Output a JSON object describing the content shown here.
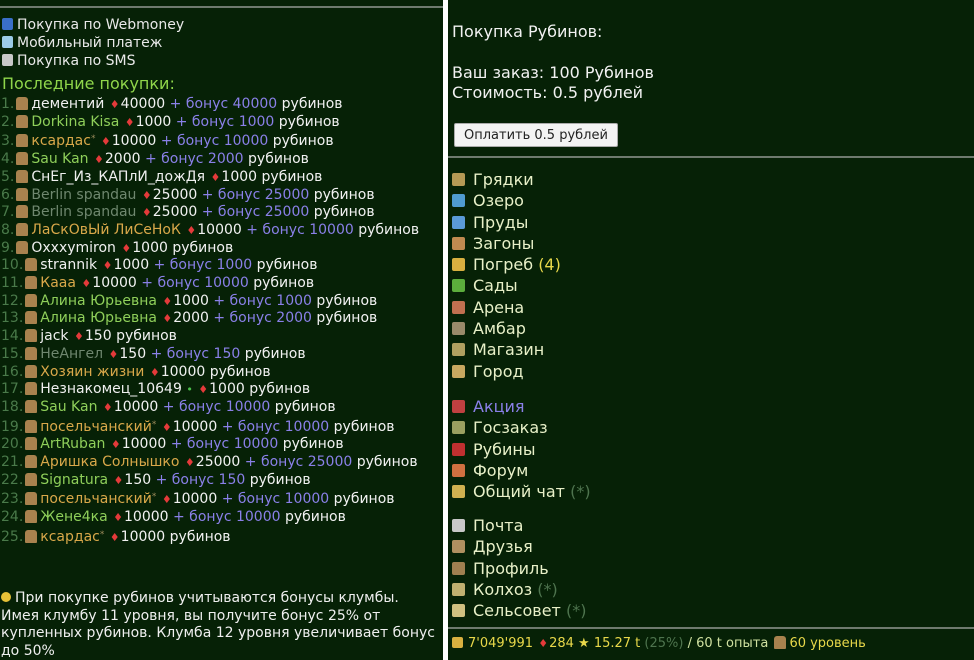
{
  "payment_methods": [
    "Покупка по Webmoney",
    "Мобильный платеж",
    "Покупка по SMS"
  ],
  "recent": {
    "title": "Последние покупки:",
    "items": [
      {
        "n": "1.",
        "name": "дементий",
        "amount": "40000",
        "bonus": "+ бонус 40000",
        "unit": "рубинов",
        "style": "w"
      },
      {
        "n": "2.",
        "name": "Dorkina Kisa",
        "amount": "1000",
        "bonus": "+ бонус 1000",
        "unit": "рубинов",
        "style": "g"
      },
      {
        "n": "3.",
        "name": "ксардас",
        "amount": "10000",
        "bonus": "+ бонус 10000",
        "unit": "рубинов",
        "style": "o",
        "star": "*"
      },
      {
        "n": "4.",
        "name": "Sau Kan",
        "amount": "2000",
        "bonus": "+ бонус 2000",
        "unit": "рубинов",
        "style": "g"
      },
      {
        "n": "5.",
        "name": "СнЕг_Из_КАПлИ_дожДя",
        "amount": "1000",
        "bonus": "",
        "unit": "рубинов",
        "style": "w"
      },
      {
        "n": "6.",
        "name": "Berlin spandau",
        "amount": "25000",
        "bonus": "+ бонус 25000",
        "unit": "рубинов",
        "style": "d"
      },
      {
        "n": "7.",
        "name": "Berlin spandau",
        "amount": "25000",
        "bonus": "+ бонус 25000",
        "unit": "рубинов",
        "style": "d"
      },
      {
        "n": "8.",
        "name": "ЛаСкОвЫй ЛиСеНоК",
        "amount": "10000",
        "bonus": "+ бонус 10000",
        "unit": "рубинов",
        "style": "o"
      },
      {
        "n": "9.",
        "name": "Oxxxymiron",
        "amount": "1000",
        "bonus": "",
        "unit": "рубинов",
        "style": "w"
      },
      {
        "n": "10.",
        "name": "strannik",
        "amount": "1000",
        "bonus": "+ бонус 1000",
        "unit": "рубинов",
        "style": "w"
      },
      {
        "n": "11.",
        "name": "Кааа",
        "amount": "10000",
        "bonus": "+ бонус 10000",
        "unit": "рубинов",
        "style": "o"
      },
      {
        "n": "12.",
        "name": "Алина Юрьевна",
        "amount": "1000",
        "bonus": "+ бонус 1000",
        "unit": "рубинов",
        "style": "g"
      },
      {
        "n": "13.",
        "name": "Алина Юрьевна",
        "amount": "2000",
        "bonus": "+ бонус 2000",
        "unit": "рубинов",
        "style": "g"
      },
      {
        "n": "14.",
        "name": "jack",
        "amount": "150",
        "bonus": "",
        "unit": "рубинов",
        "style": "w"
      },
      {
        "n": "15.",
        "name": "НеАнгел",
        "amount": "150",
        "bonus": "+ бонус 150",
        "unit": "рубинов",
        "style": "d"
      },
      {
        "n": "16.",
        "name": "Хозяин жизни",
        "amount": "10000",
        "bonus": "",
        "unit": "рубинов",
        "style": "o"
      },
      {
        "n": "17.",
        "name": "Незнакомец_10649",
        "amount": "1000",
        "bonus": "",
        "unit": "рубинов",
        "style": "w",
        "dot": "•"
      },
      {
        "n": "18.",
        "name": "Sau Kan",
        "amount": "10000",
        "bonus": "+ бонус 10000",
        "unit": "рубинов",
        "style": "g"
      },
      {
        "n": "19.",
        "name": "посельчанский",
        "amount": "10000",
        "bonus": "+ бонус 10000",
        "unit": "рубинов",
        "style": "o",
        "star": "*"
      },
      {
        "n": "20.",
        "name": "ArtRuban",
        "amount": "10000",
        "bonus": "+ бонус 10000",
        "unit": "рубинов",
        "style": "g"
      },
      {
        "n": "21.",
        "name": "Аришка Солнышко",
        "amount": "25000",
        "bonus": "+ бонус 25000",
        "unit": "рубинов",
        "style": "o"
      },
      {
        "n": "22.",
        "name": "Signatura",
        "amount": "150",
        "bonus": "+ бонус 150",
        "unit": "рубинов",
        "style": "g"
      },
      {
        "n": "23.",
        "name": "посельчанский",
        "amount": "10000",
        "bonus": "+ бонус 10000",
        "unit": "рубинов",
        "style": "o",
        "star": "*"
      },
      {
        "n": "24.",
        "name": "Жене4ка",
        "amount": "10000",
        "bonus": "+ бонус 10000",
        "unit": "рубинов",
        "style": "g"
      },
      {
        "n": "25.",
        "name": "ксардас",
        "amount": "10000",
        "bonus": "",
        "unit": "рубинов",
        "style": "o",
        "star": "*"
      }
    ]
  },
  "note": "При покупке рубинов учитываются бонусы клумбы. Имея клумбу 11 уровня, вы получите бонус 25% от купленных рубинов. Клумба 12 уровня увеличивает бонус до 50%",
  "order": {
    "title": "Покупка Рубинов:",
    "line1": "Ваш заказ: 100 Рубинов",
    "line2": "Стоимость: 0.5 рублей",
    "button": "Оплатить 0.5 рублей"
  },
  "menu_groups": [
    [
      {
        "label": "Грядки",
        "icon": "garden-beds-icon"
      },
      {
        "label": "Озеро",
        "icon": "lake-icon"
      },
      {
        "label": "Пруды",
        "icon": "ponds-icon"
      },
      {
        "label": "Загоны",
        "icon": "pens-icon"
      },
      {
        "label": "Погреб",
        "icon": "cellar-icon",
        "count": "(4)"
      },
      {
        "label": "Сады",
        "icon": "orchard-icon"
      },
      {
        "label": "Арена",
        "icon": "arena-icon"
      },
      {
        "label": "Амбар",
        "icon": "barn-icon"
      },
      {
        "label": "Магазин",
        "icon": "shop-icon"
      },
      {
        "label": "Город",
        "icon": "city-icon"
      }
    ],
    [
      {
        "label": "Акция",
        "icon": "promo-icon",
        "highlight": true
      },
      {
        "label": "Госзаказ",
        "icon": "state-order-icon"
      },
      {
        "label": "Рубины",
        "icon": "rubies-icon"
      },
      {
        "label": "Форум",
        "icon": "forum-icon"
      },
      {
        "label": "Общий чат",
        "icon": "chat-icon",
        "suffix": "(*)"
      }
    ],
    [
      {
        "label": "Почта",
        "icon": "mail-icon"
      },
      {
        "label": "Друзья",
        "icon": "friends-icon"
      },
      {
        "label": "Профиль",
        "icon": "profile-icon"
      },
      {
        "label": "Колхоз",
        "icon": "kolkhoz-icon",
        "suffix": "(*)"
      },
      {
        "label": "Сельсовет",
        "icon": "village-council-icon",
        "suffix": "(*)"
      }
    ]
  ],
  "status": {
    "coins": "7'049'991",
    "rubies": "284",
    "xp": "15.27 t",
    "xp_pct": "(25%)",
    "xp_goal": "/ 60 t опыта",
    "level": "60 уровень"
  },
  "colors": {
    "background": "#062106",
    "bonus": "#8a80e8",
    "header": "#8fd64a",
    "count": "#e8d84a"
  }
}
